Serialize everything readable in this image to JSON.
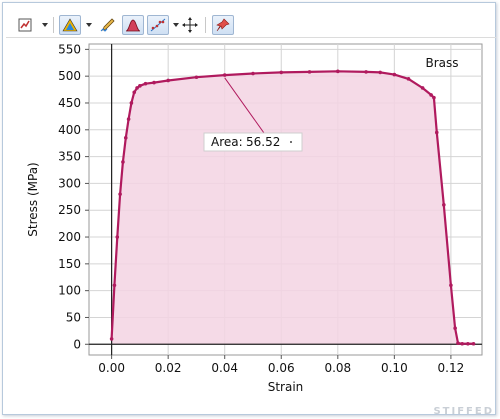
{
  "toolbar": {
    "items": [
      {
        "icon": "chart-properties-icon",
        "pressed": false,
        "dropdown": true
      },
      {
        "icon": "triangle-colors-icon",
        "pressed": true,
        "dropdown": true
      },
      {
        "icon": "pencil-draw-icon",
        "pressed": false,
        "dropdown": false
      },
      {
        "icon": "area-peak-icon",
        "pressed": true,
        "dropdown": false
      },
      {
        "icon": "curve-fit-icon",
        "pressed": true,
        "dropdown": true
      },
      {
        "icon": "move-crosshair-icon",
        "pressed": false,
        "dropdown": false
      },
      {
        "icon": "pin-annotation-icon",
        "pressed": true,
        "dropdown": false
      }
    ]
  },
  "chart_data": {
    "type": "area",
    "title": "",
    "xlabel": "Strain",
    "ylabel": "Stress (MPa)",
    "xlim": [
      -0.008,
      0.131
    ],
    "ylim": [
      -20,
      560
    ],
    "xticks": [
      0.0,
      0.02,
      0.04,
      0.06,
      0.08,
      0.1,
      0.12
    ],
    "xtick_labels": [
      "0.00",
      "0.02",
      "0.04",
      "0.06",
      "0.08",
      "0.10",
      "0.12"
    ],
    "yticks": [
      0,
      50,
      100,
      150,
      200,
      250,
      300,
      350,
      400,
      450,
      500,
      550
    ],
    "ytick_labels": [
      "0",
      "50",
      "100",
      "150",
      "200",
      "250",
      "300",
      "350",
      "400",
      "450",
      "500",
      "550"
    ],
    "grid": true,
    "colors": {
      "line": "#b01a5e",
      "fill": "#f3d3e3",
      "grid": "#d4d4d4",
      "axis": "#222222"
    },
    "series": [
      {
        "name": "Brass",
        "x": [
          0.0,
          0.001,
          0.002,
          0.003,
          0.004,
          0.005,
          0.006,
          0.007,
          0.008,
          0.009,
          0.01,
          0.012,
          0.015,
          0.02,
          0.03,
          0.04,
          0.05,
          0.06,
          0.07,
          0.08,
          0.09,
          0.095,
          0.1,
          0.105,
          0.11,
          0.113,
          0.114,
          0.115,
          0.1175,
          0.12,
          0.1215,
          0.1225,
          0.124,
          0.126,
          0.128
        ],
        "y": [
          10,
          110,
          200,
          280,
          340,
          385,
          420,
          450,
          470,
          478,
          482,
          486,
          488,
          492,
          498,
          502,
          505,
          507,
          508,
          509,
          508,
          507,
          503,
          495,
          478,
          465,
          460,
          395,
          260,
          110,
          30,
          2,
          1,
          1,
          1
        ]
      }
    ],
    "legend": {
      "entries": [
        "Brass"
      ],
      "placement": "top-right"
    },
    "annotation": {
      "label": "Area:",
      "value": "56.52",
      "x": 0.04,
      "y": 497
    }
  },
  "watermark": "STIFFED"
}
